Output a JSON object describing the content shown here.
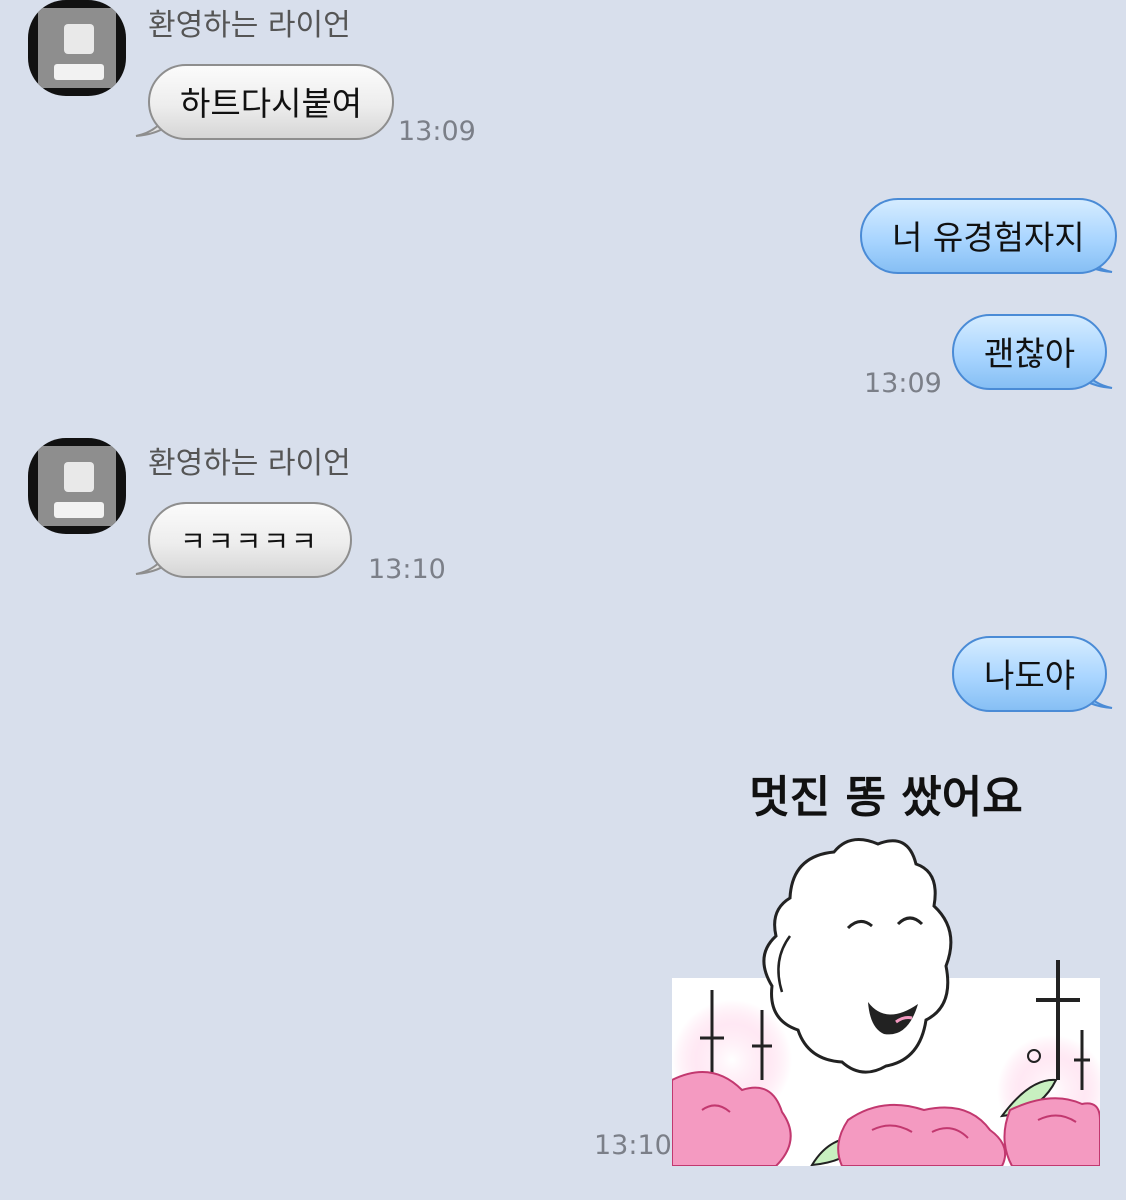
{
  "messages": [
    {
      "sender": "환영하는 라이언",
      "text": "하트다시붙여",
      "time": "13:09"
    },
    {
      "text": "너 유경험자지"
    },
    {
      "text": "괜찮아",
      "time": "13:09"
    },
    {
      "sender": "환영하는 라이언",
      "text": "ㅋㅋㅋㅋㅋ",
      "time": "13:10"
    },
    {
      "text": "나도야"
    }
  ],
  "sticker": {
    "caption": "멋진 똥 쌌어요",
    "time": "13:10"
  },
  "colors": {
    "background": "#d8dfec",
    "incoming_bubble": "#eeeeee",
    "outgoing_bubble": "#a9d5ff",
    "flowers": "#f49ac1"
  }
}
